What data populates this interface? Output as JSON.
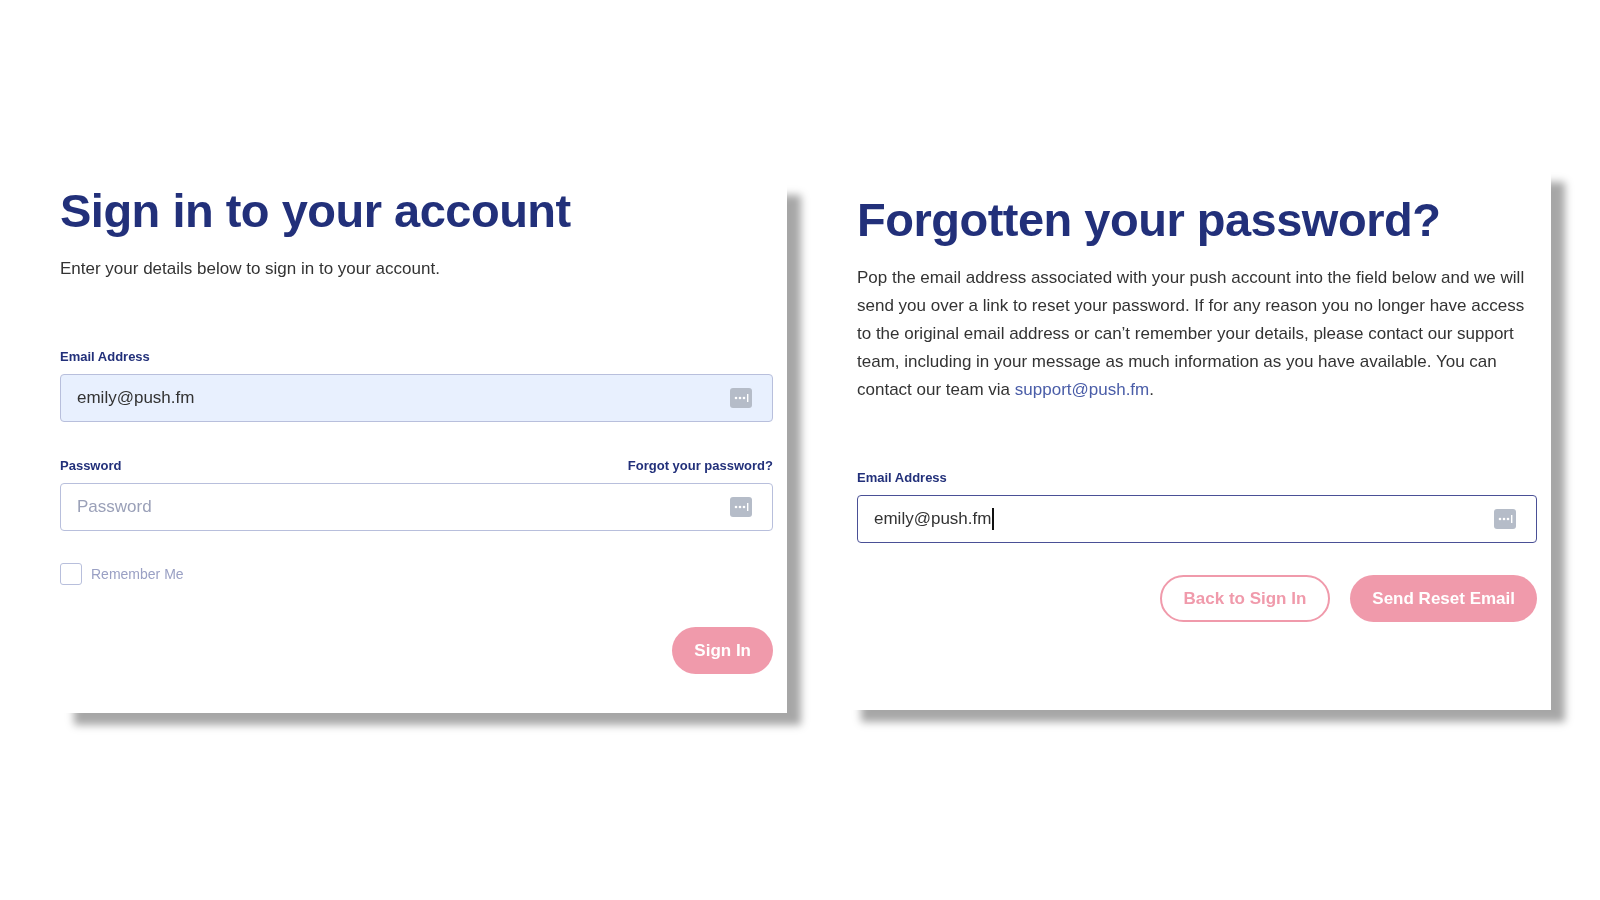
{
  "sign_in": {
    "title": "Sign in to your account",
    "subtitle": "Enter your details below to sign in to your account.",
    "email": {
      "label": "Email Address",
      "value": "emily@push.fm",
      "autofilled": true,
      "focused": false
    },
    "password": {
      "label": "Password",
      "placeholder": "Password",
      "autofilled": false,
      "focused": false
    },
    "forgot_link": "Forgot your password?",
    "remember": {
      "label": "Remember Me",
      "checked": false
    },
    "button": "Sign In"
  },
  "forgot": {
    "title": "Forgotten your password?",
    "body": "Pop the email address associated with your push account into the field below and we will send you over a link to reset your password. If for any reason you no longer have access to the original email address or can’t remember your details, please contact our support team, including in your message as much information as you have available.  You can contact our team via ",
    "link": "support@push.fm",
    "body_end": ".",
    "email": {
      "label": "Email Address",
      "value": "emily@push.fm",
      "autofilled": false,
      "focused": true
    },
    "buttons": [
      {
        "label": "Back to Sign In",
        "kind": "outline"
      },
      {
        "label": "Send Reset Email",
        "kind": "filled"
      }
    ]
  }
}
